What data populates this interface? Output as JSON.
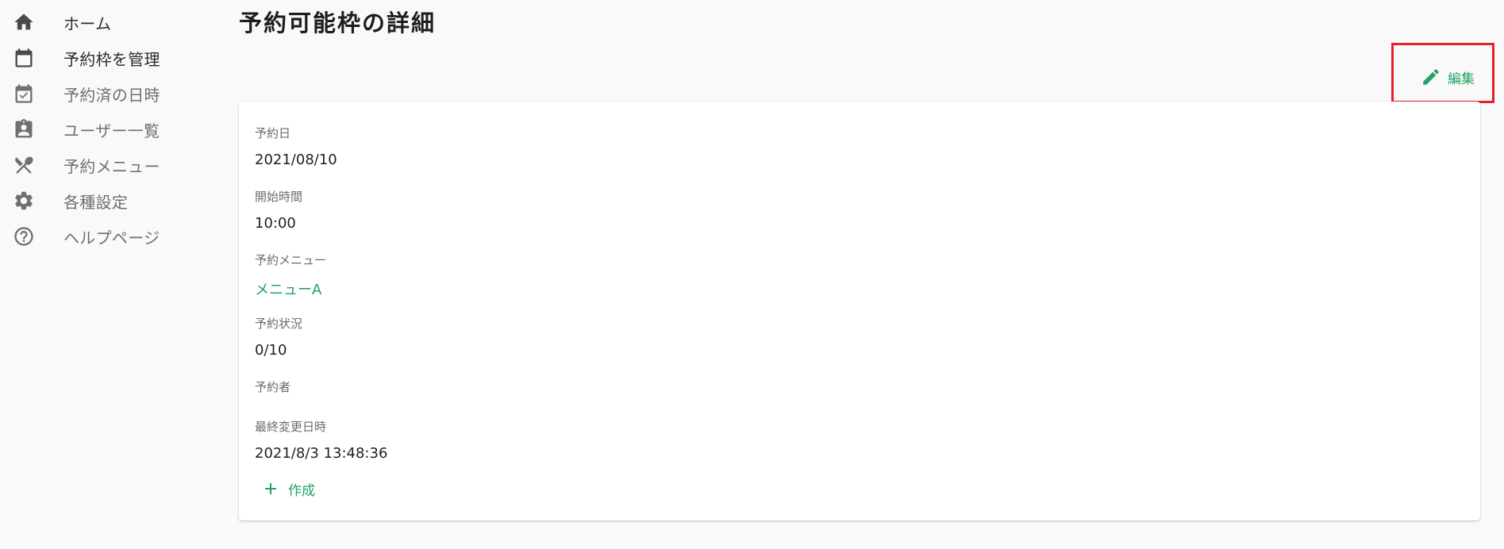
{
  "sidebar": {
    "items": [
      {
        "label": "ホーム",
        "icon": "home-icon",
        "state": "active"
      },
      {
        "label": "予約枠を管理",
        "icon": "calendar-icon",
        "state": "active"
      },
      {
        "label": "予約済の日時",
        "icon": "calendar-check-icon",
        "state": "muted"
      },
      {
        "label": "ユーザー一覧",
        "icon": "clipboard-user-icon",
        "state": "muted"
      },
      {
        "label": "予約メニュー",
        "icon": "utensils-icon",
        "state": "muted"
      },
      {
        "label": "各種設定",
        "icon": "gear-icon",
        "state": "muted"
      },
      {
        "label": "ヘルプページ",
        "icon": "help-circle-icon",
        "state": "muted"
      }
    ]
  },
  "page": {
    "title": "予約可能枠の詳細",
    "edit_label": "編集"
  },
  "details": {
    "date_label": "予約日",
    "date_value": "2021/08/10",
    "start_label": "開始時間",
    "start_value": "10:00",
    "menu_label": "予約メニュー",
    "menu_value": "メニューA",
    "status_label": "予約状況",
    "status_value": "0/10",
    "reserver_label": "予約者",
    "updated_label": "最終変更日時",
    "updated_value": "2021/8/3 13:48:36",
    "create_label": "作成"
  },
  "colors": {
    "accent": "#21a463",
    "highlight": "#e5202a",
    "icon_active": "#4a4a4a",
    "icon_muted": "#707070"
  }
}
